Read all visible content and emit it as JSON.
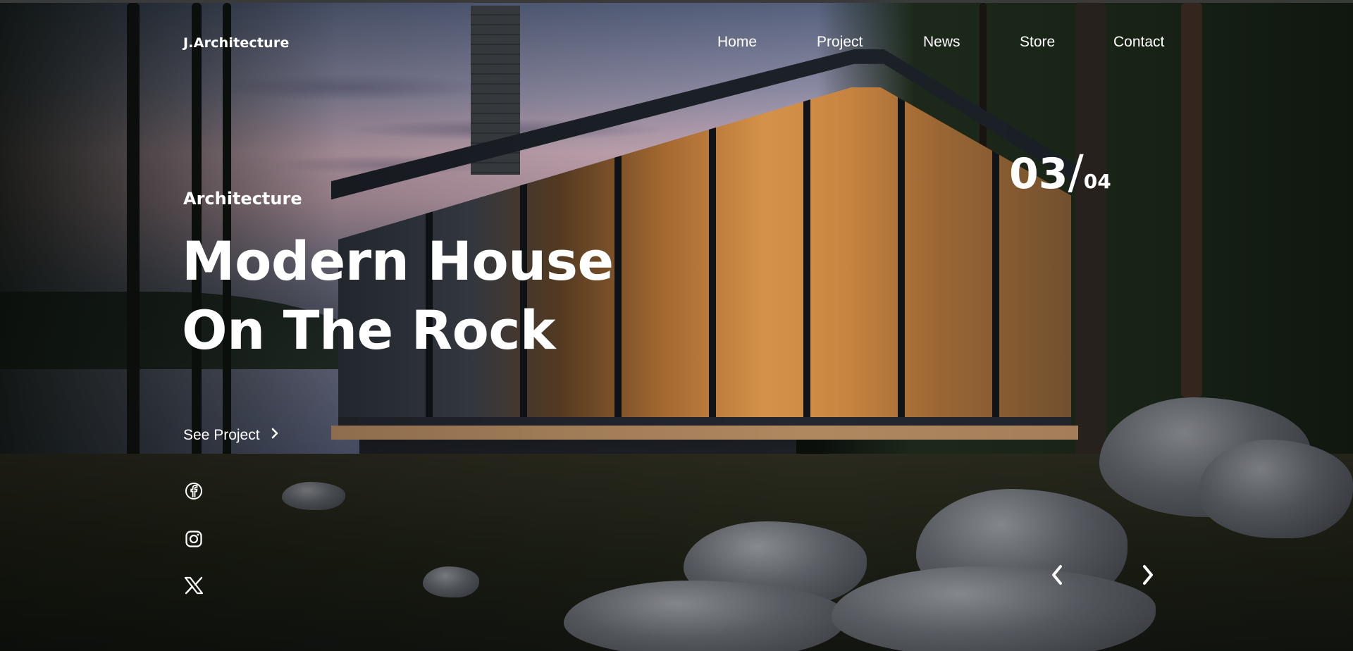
{
  "brand": "J.Architecture",
  "nav": {
    "items": [
      {
        "label": "Home"
      },
      {
        "label": "Project"
      },
      {
        "label": "News"
      },
      {
        "label": "Store"
      },
      {
        "label": "Contact"
      }
    ]
  },
  "hero": {
    "category": "Architecture",
    "title_line_1": "Modern House",
    "title_line_2": "On The Rock",
    "cta_label": "See Project",
    "cta_icon": "chevron-right-icon"
  },
  "slider": {
    "current": "03",
    "separator": "/",
    "total": "04",
    "prev_icon": "chevron-left-icon",
    "next_icon": "chevron-right-icon"
  },
  "social": [
    {
      "name": "facebook-icon"
    },
    {
      "name": "instagram-icon"
    },
    {
      "name": "x-twitter-icon"
    }
  ],
  "colors": {
    "text": "#ffffff",
    "accent_glow": "#d8944a"
  }
}
